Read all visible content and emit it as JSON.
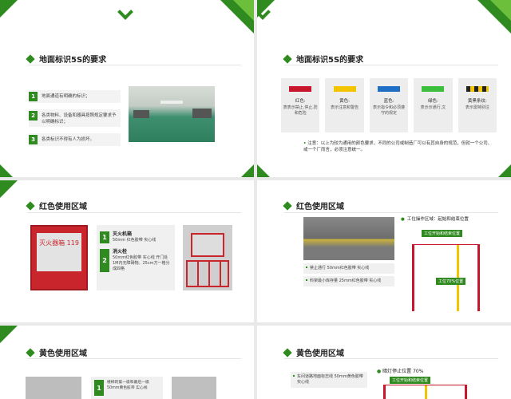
{
  "colors": {
    "green": "#2f8a1f",
    "light_green": "#6bbf3b",
    "red": "#c8162c",
    "yellow": "#f2c500",
    "blue": "#1f6fc7",
    "lime": "#3cbf3c",
    "black": "#222222"
  },
  "slide1": {
    "title": "地面标识5S的要求",
    "items": [
      {
        "num": "1",
        "text": "地面通道有明确的标识；"
      },
      {
        "num": "2",
        "text": "各类物料、设备和器具按照规定要求予以明确标识；"
      },
      {
        "num": "3",
        "text": "各类标识不得有人为损坏。"
      }
    ],
    "photo_icon": "factory-photo"
  },
  "slide2": {
    "title": "地面标识5S的要求",
    "swatches": [
      {
        "name": "红色:",
        "desc": "表表示禁止,停止,防和危险",
        "color": "#c8162c"
      },
      {
        "name": "黄色:",
        "desc": "表示注意和警告",
        "color": "#f2c500"
      },
      {
        "name": "蓝色:",
        "desc": "表示指令和必须遵守的规定",
        "color": "#1f6fc7"
      },
      {
        "name": "绿色:",
        "desc": "表示示通行,文",
        "color": "#3cbf3c"
      },
      {
        "name": "黄黑条纹:",
        "desc": "表示需特别注",
        "color": "stripe"
      }
    ],
    "note_prefix": "注意：",
    "note_text": "以上为较为通用的颜色要求，不同的公司或制造厂可以有其自身的规范，但就一个公司、或一个厂而言，必须注意统一。"
  },
  "slide3": {
    "title": "红色使用区域",
    "cabinet_label": "灭火器箱 119",
    "items": [
      {
        "num": "1",
        "head": "灭火机箱",
        "desc": "50mm 红色胶带 实心线"
      },
      {
        "num": "2",
        "head": "消火栓",
        "desc": "50mm红色胶带 实心线 开门处1M内无障碍物。25cm方一格分成四格"
      }
    ]
  },
  "slide4": {
    "title": "红色使用区域",
    "items": [
      "禁止通行 50mm红色胶带 实心线",
      "料架最小库存量 25mm红色胶带 实心线"
    ],
    "tip": "工位操作区域：起始和结束位置",
    "labels": [
      "工位开始和结束位置",
      "工位70%位置"
    ]
  },
  "slide5": {
    "title": "黄色使用区域",
    "box_num": "1",
    "box_lines": [
      "楼梯的第一级和最后一级",
      "50mm黄色胶带 实心线"
    ]
  },
  "slide6": {
    "title": "黄色使用区域",
    "items": [
      "车间道路地面标志线 50mm黄色胶带 实心线"
    ],
    "tip": "暗灯停止位置 70%",
    "label": "工位开始和结束位置"
  }
}
